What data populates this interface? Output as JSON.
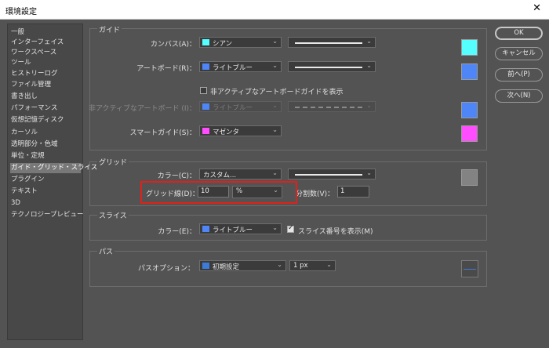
{
  "window": {
    "title": "環境設定",
    "close_glyph": "✕"
  },
  "sidebar": {
    "items": [
      {
        "label": "一般"
      },
      {
        "label": "インターフェイス"
      },
      {
        "label": "ワークスペース"
      },
      {
        "label": "ツール"
      },
      {
        "label": "ヒストリーログ"
      },
      {
        "label": "ファイル管理"
      },
      {
        "label": "書き出し"
      },
      {
        "label": "パフォーマンス"
      },
      {
        "label": "仮想記憶ディスク"
      },
      {
        "label": "カーソル"
      },
      {
        "label": "透明部分・色域"
      },
      {
        "label": "単位・定規"
      },
      {
        "label": "ガイド・グリッド・スライス",
        "selected": true
      },
      {
        "label": "プラグイン"
      },
      {
        "label": "テキスト"
      },
      {
        "label": "3D"
      },
      {
        "label": "テクノロジープレビュー"
      }
    ]
  },
  "guide": {
    "title": "ガイド",
    "canvas": {
      "label": "カンバス(A)：",
      "value": "シアン",
      "color": "#55ffff"
    },
    "artboard": {
      "label": "アートボード(R)：",
      "value": "ライトブルー",
      "color": "#4f86f7"
    },
    "inactive_checkbox_label": "非アクティブなアートボードガイドを表示",
    "inactive_artboard": {
      "label": "非アクティブなアートボード (I)：",
      "value": "ライトブルー",
      "color": "#4f86f7"
    },
    "smart": {
      "label": "スマートガイド(S)：",
      "value": "マゼンタ",
      "color": "#ff4dff"
    }
  },
  "grid": {
    "title": "グリッド",
    "color": {
      "label": "カラー(C)：",
      "value": "カスタム...",
      "color": "#838383"
    },
    "gridline": {
      "label": "グリッド線(D)：",
      "value": "10",
      "unit": "%"
    },
    "subdivisions": {
      "label": "分割数(V)：",
      "value": "1"
    }
  },
  "slice": {
    "title": "スライス",
    "color": {
      "label": "カラー(E)：",
      "value": "ライトブルー",
      "color": "#4f86f7"
    },
    "show_number_label": "スライス番号を表示(M)",
    "show_number_checked": true
  },
  "path": {
    "title": "パス",
    "options_label": "パスオプション：",
    "preset": {
      "value": "初期設定",
      "color": "#3d7bd6"
    },
    "width": "1 px"
  },
  "buttons": {
    "ok": "OK",
    "cancel": "キャンセル",
    "prev": "前へ(P)",
    "next": "次へ(N)"
  }
}
